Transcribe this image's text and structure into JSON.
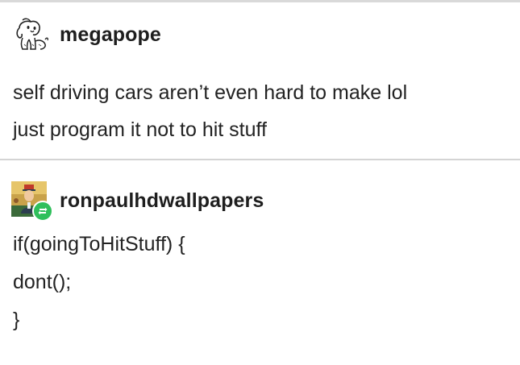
{
  "posts": [
    {
      "username": "megapope",
      "lines": [
        "self driving cars aren’t even hard to make lol",
        "just program it not to hit stuff"
      ],
      "avatar_icon": "dog-sketch-icon"
    },
    {
      "username": "ronpaulhdwallpapers",
      "lines": [
        "if(goingToHitStuff) {",
        "dont();",
        "}"
      ],
      "avatar_icon": "ronpaul-portrait-icon",
      "badge_icon": "reblog-icon",
      "badge_color": "#2fbf5b"
    }
  ]
}
